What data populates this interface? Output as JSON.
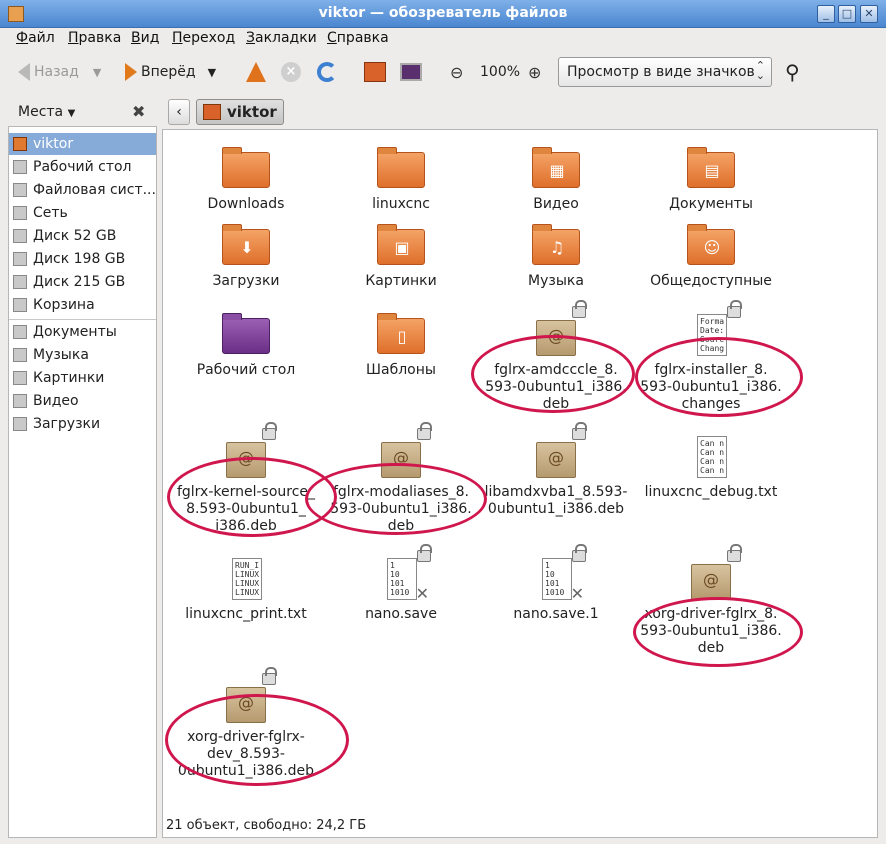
{
  "window": {
    "title": "viktor — обозреватель файлов"
  },
  "menu": [
    "Файл",
    "Правка",
    "Вид",
    "Переход",
    "Закладки",
    "Справка"
  ],
  "toolbar": {
    "back_label": "Назад",
    "forward_label": "Вперёд",
    "zoom": "100%",
    "view_mode": "Просмотр в виде значков"
  },
  "sidebar": {
    "title": "Места",
    "items": [
      {
        "label": "viktor",
        "selected": true
      },
      {
        "label": "Рабочий стол"
      },
      {
        "label": "Файловая сист..."
      },
      {
        "label": "Сеть"
      },
      {
        "label": "Диск 52 GB"
      },
      {
        "label": "Диск 198 GB"
      },
      {
        "label": "Диск 215 GB"
      },
      {
        "label": "Корзина"
      }
    ],
    "bookmarks": [
      {
        "label": "Документы"
      },
      {
        "label": "Музыка"
      },
      {
        "label": "Картинки"
      },
      {
        "label": "Видео"
      },
      {
        "label": "Загрузки"
      }
    ]
  },
  "pathbar": {
    "current": "viktor"
  },
  "files": [
    {
      "name": "Downloads",
      "icon": "folder-icon"
    },
    {
      "name": "linuxcnc",
      "icon": "folder-icon"
    },
    {
      "name": "Видео",
      "icon": "folder-video-icon"
    },
    {
      "name": "Документы",
      "icon": "folder-documents-icon"
    },
    {
      "name": "Загрузки",
      "icon": "folder-downloads-icon"
    },
    {
      "name": "Картинки",
      "icon": "folder-pictures-icon"
    },
    {
      "name": "Музыка",
      "icon": "folder-music-icon"
    },
    {
      "name": "Общедоступные",
      "icon": "folder-public-icon"
    },
    {
      "name": "Рабочий стол",
      "icon": "folder-desktop-icon"
    },
    {
      "name": "Шаблоны",
      "icon": "folder-templates-icon"
    },
    {
      "name": "fglrx-amdcccle_8.\n593-0ubuntu1_i386.\ndeb",
      "icon": "debian-package-icon"
    },
    {
      "name": "fglrx-installer_8.\n593-0ubuntu1_i386.\nchanges",
      "icon": "text-file-icon",
      "preview": "Forma\nDate:\nSourc\nChang"
    },
    {
      "name": "fglrx-kernel-source_\n8.593-0ubuntu1_\ni386.deb",
      "icon": "debian-package-icon"
    },
    {
      "name": "fglrx-modaliases_8.\n593-0ubuntu1_i386.\ndeb",
      "icon": "debian-package-icon"
    },
    {
      "name": "libamdxvba1_8.593-\n0ubuntu1_i386.deb",
      "icon": "debian-package-icon"
    },
    {
      "name": "linuxcnc_debug.txt",
      "icon": "text-file-icon",
      "preview": "Can n\nCan n\nCan n\nCan n"
    },
    {
      "name": "linuxcnc_print.txt",
      "icon": "text-file-icon",
      "preview": "RUN_I\nLINUX\nLINUX\nLINUX"
    },
    {
      "name": "nano.save",
      "icon": "binary-file-icon",
      "preview": "1\n10\n101\n1010"
    },
    {
      "name": "nano.save.1",
      "icon": "binary-file-icon",
      "preview": "1\n10\n101\n1010"
    },
    {
      "name": "xorg-driver-fglrx_8.\n593-0ubuntu1_i386.\ndeb",
      "icon": "debian-package-icon"
    },
    {
      "name": "xorg-driver-fglrx-\ndev_8.593-\n0ubuntu1_i386.deb",
      "icon": "debian-package-icon"
    }
  ],
  "status": "21 объект, свободно: 24,2 ГБ"
}
